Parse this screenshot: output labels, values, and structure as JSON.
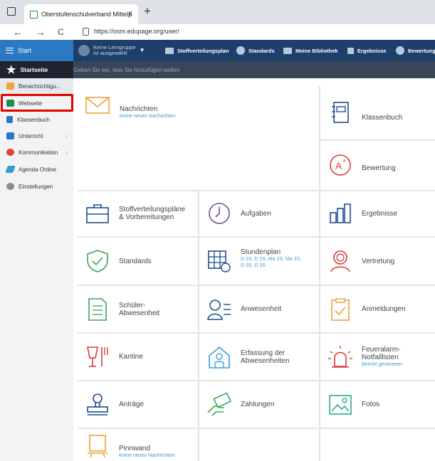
{
  "browser": {
    "tab_title": "Oberstufenschulverband Mittelp",
    "tab_close": "x",
    "new_tab": "+",
    "back": "←",
    "forward": "→",
    "reload": "C",
    "url": "https://osm.edupage.org/user/"
  },
  "topbar": {
    "start_label": "Start",
    "group_line1": "Keine Lerngruppe",
    "group_line2": "ist ausgewählt",
    "items": [
      "Stoffverteilungsplan",
      "Standards",
      "Meine Bibliothek",
      "Ergebnisse",
      "Bewertung"
    ]
  },
  "search": {
    "placeholder": "Geben Sie ein, was Sie hinzufügen wollen"
  },
  "sidebar": {
    "home": "Startseite",
    "items": [
      {
        "label": "Benachrichtigu...",
        "icon": "envelope-icon",
        "color": "#f2a33a"
      },
      {
        "label": "Webseite",
        "icon": "home-icon",
        "color": "#1f8f4e"
      },
      {
        "label": "Klassenbuch",
        "icon": "book-icon",
        "color": "#2b79c2"
      },
      {
        "label": "Unterricht",
        "icon": "class-icon",
        "color": "#2b79c2"
      },
      {
        "label": "Kommunikation",
        "icon": "chat-icon",
        "color": "#e0402a"
      },
      {
        "label": "Agenda Online",
        "icon": "pencil-icon",
        "color": "#3a9bd9"
      },
      {
        "label": "Einstellungen",
        "icon": "gear-icon",
        "color": "#8a8a8a"
      }
    ]
  },
  "tiles": {
    "nachrichten": {
      "label": "Nachrichten",
      "sub": "Keine neuen Nachrichten"
    },
    "klassenbuch": {
      "label": "Klassenbuch"
    },
    "bewertung": {
      "label": "Bewertung"
    },
    "stoffverteilung": {
      "line1": "Stoffverteilungspläne",
      "line2": "& Vorbereitungen"
    },
    "aufgaben": {
      "label": "Aufgaben"
    },
    "ergebnisse": {
      "label": "Ergebnisse"
    },
    "standards": {
      "label": "Standards"
    },
    "stundenplan": {
      "label": "Stundenplan",
      "sub1": "D 2S, D 2S, Ma 2S, Ma 2S,",
      "sub2": "D 3S, D 3S"
    },
    "vertretung": {
      "label": "Vertretung"
    },
    "schueler": {
      "line1": "Schüler-",
      "line2": "Abwesenheit"
    },
    "anwesenheit": {
      "label": "Anwesenheit"
    },
    "anmeldungen": {
      "label": "Anmeldungen"
    },
    "kantine": {
      "label": "Kantine"
    },
    "erfassung": {
      "line1": "Erfassung der",
      "line2": "Abwesenheiten"
    },
    "feueralarm": {
      "line1": "Feueralarm-",
      "line2": "Notfalllisten",
      "sub": "Bericht generieren"
    },
    "antraege": {
      "label": "Anträge"
    },
    "zahlungen": {
      "label": "Zahlungen"
    },
    "fotos": {
      "label": "Fotos"
    },
    "pinnwand": {
      "label": "Pinnwand",
      "sub": "Keine neuen Nachrichten"
    }
  },
  "colors": {
    "orange": "#f0a030",
    "blue": "#1e4f8c",
    "teal": "#2fa58f",
    "red": "#d93a3a",
    "green": "#3aa655",
    "purple": "#6b4f9a"
  }
}
